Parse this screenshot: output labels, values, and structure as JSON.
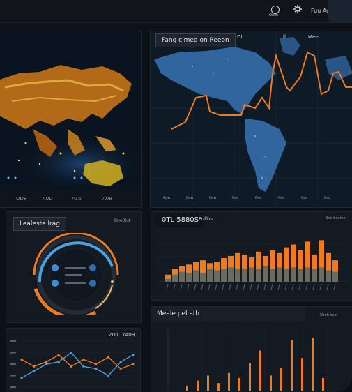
{
  "topbar": {
    "label_1": "Oooo",
    "label_2": "Fuu Ao"
  },
  "map_panel_left": {
    "bottom_labels": [
      "OD8",
      "A0D",
      "A16",
      "A08"
    ]
  },
  "map_panel_right": {
    "title": "Fang clmed on Reeon",
    "header_small": [
      "DII",
      "ll",
      "Mee"
    ],
    "tick_labels_bottom": [
      "0ew",
      "0ew",
      "0ew",
      "0ee",
      "0ee",
      "0ee",
      "0ee",
      "0ee"
    ]
  },
  "gauge_panel": {
    "title": "Lealeste lrag",
    "badge": "Bne0lut"
  },
  "bar_panel": {
    "title": "0TL 5880S",
    "subtitle": "Fullbs",
    "badge": "Bne beeme"
  },
  "line_panel": {
    "label_1": "Zu0",
    "label_2": "7A0B"
  },
  "lower_bar_panel": {
    "title": "Meale pel ath",
    "badge": "Slreh hear"
  },
  "colors": {
    "orange": "#f07a1e",
    "blue": "#4aa3df",
    "grey_bar": "#6b6a5e",
    "panel": "#141a21"
  },
  "chart_data": [
    {
      "type": "bar",
      "title": "0TL 5880S",
      "series": [
        {
          "values": [
            10,
            18,
            22,
            24,
            28,
            30,
            26,
            28,
            33,
            36,
            40,
            38,
            34,
            42,
            36,
            44,
            40,
            48,
            52,
            44,
            56,
            38,
            58,
            40,
            30
          ]
        },
        {
          "values": [
            4,
            10,
            14,
            12,
            16,
            12,
            18,
            16,
            18,
            20,
            18,
            18,
            20,
            18,
            22,
            18,
            20,
            18,
            20,
            18,
            20,
            18,
            20,
            16,
            14
          ]
        }
      ],
      "ylim": [
        0,
        70
      ]
    },
    {
      "type": "line",
      "series": [
        {
          "values": [
            8,
            14,
            20,
            22,
            30,
            18,
            16,
            10,
            22,
            28
          ]
        },
        {
          "values": [
            24,
            18,
            22,
            28,
            18,
            24,
            20,
            26,
            16,
            20
          ]
        }
      ],
      "ylim": [
        0,
        40
      ]
    },
    {
      "type": "bar",
      "title": "Meale pel ath",
      "series": [
        {
          "values": [
            4,
            8,
            12,
            6,
            14,
            10,
            22,
            32,
            12,
            18,
            40,
            26,
            42,
            10
          ]
        }
      ],
      "ylim": [
        0,
        50
      ]
    }
  ]
}
